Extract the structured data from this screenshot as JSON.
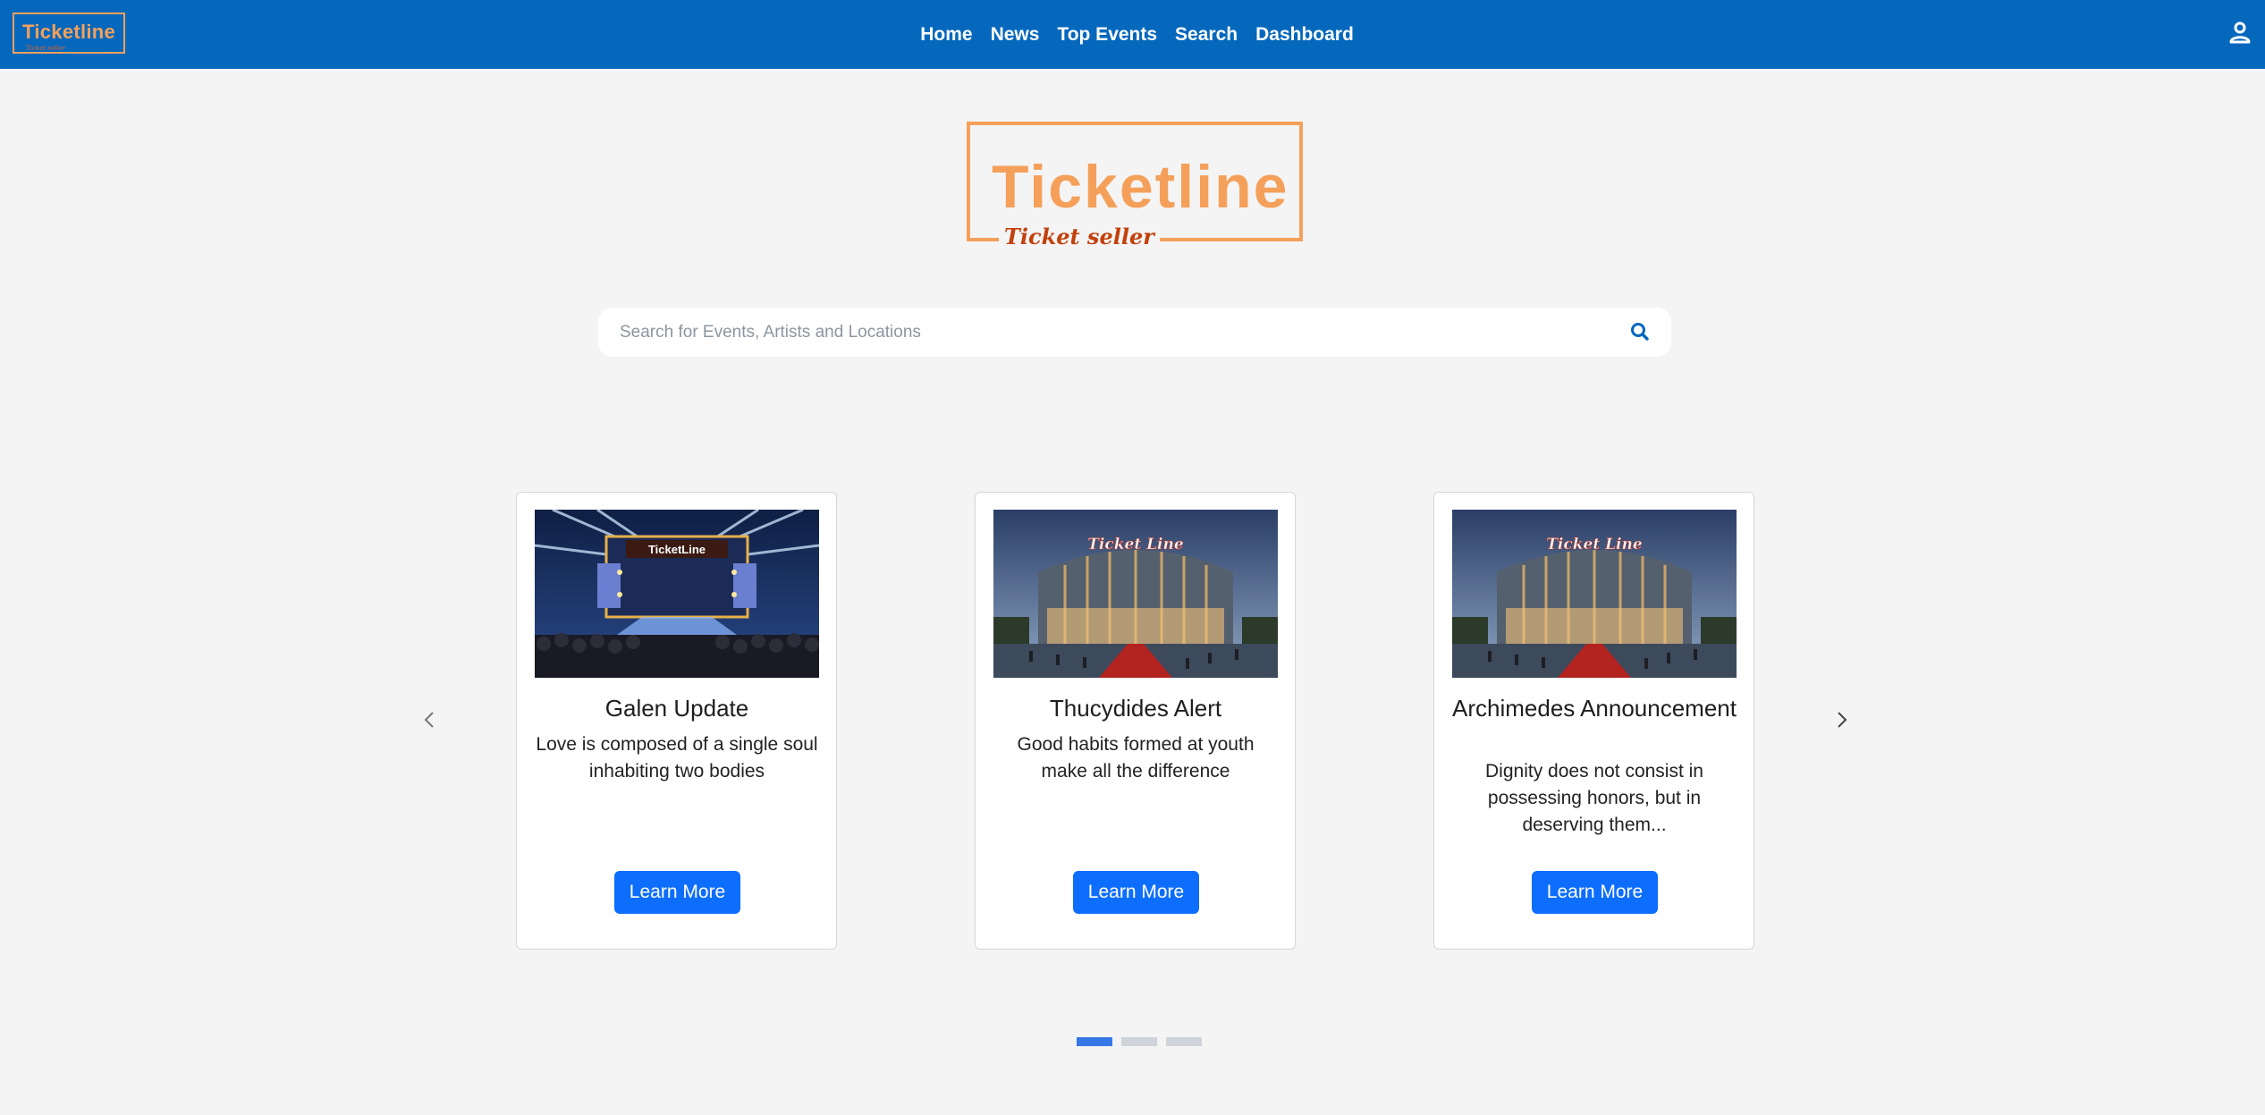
{
  "colors": {
    "navbar": "#0568bd",
    "brand_orange": "#f5a05a",
    "button_primary": "#0d6efd",
    "indicator_active": "#3578e5",
    "background": "#f4f4f4"
  },
  "navbar": {
    "logo_title": "Ticketline",
    "logo_subtitle": "Ticket seller",
    "links": [
      "Home",
      "News",
      "Top Events",
      "Search",
      "Dashboard"
    ],
    "user_icon": "user-icon"
  },
  "hero": {
    "logo_title": "Ticketline",
    "logo_subtitle": "Ticket seller"
  },
  "search": {
    "placeholder": "Search for Events, Artists and Locations",
    "value": "",
    "icon": "search-icon"
  },
  "carousel": {
    "prev_icon": "chevron-left-icon",
    "next_icon": "chevron-right-icon",
    "cards": [
      {
        "title": "Galen Update",
        "text": "Love is composed of a single soul inhabiting two bodies",
        "button": "Learn More",
        "image": "concert-stage-image"
      },
      {
        "title": "Thucydides Alert",
        "text": "Good habits formed at youth make all the difference",
        "button": "Learn More",
        "image": "arena-building-image"
      },
      {
        "title": "Archimedes Announcement",
        "text": "Dignity does not consist in possessing honors, but in deserving them...",
        "button": "Learn More",
        "image": "arena-building-image"
      }
    ],
    "indicator_count": 3,
    "active_indicator": 1
  }
}
